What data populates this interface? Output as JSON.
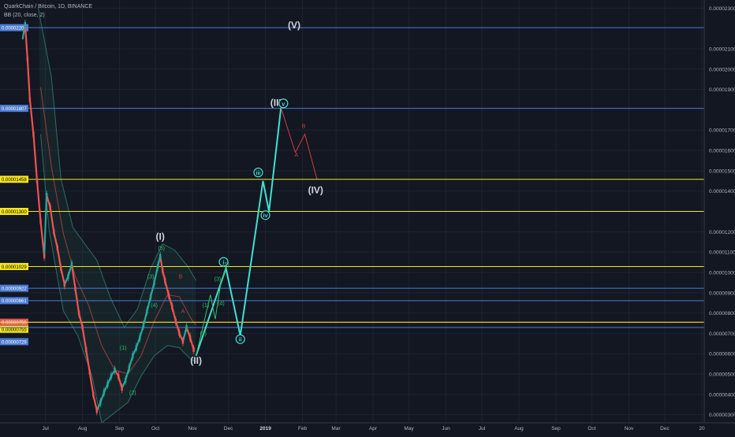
{
  "header": {
    "symbol_line": "QuarkChain / Bitcoin, 1D, BINANCE",
    "indicator_line": "BB (20, close, 2)"
  },
  "colors": {
    "background": "#131722",
    "grid": "#1f2330",
    "candle_up": "#26a69a",
    "candle_down": "#ef5350",
    "bb_band": "#2b6f5f",
    "bb_basis": "#9a3d3d",
    "wave_main": "#40e0d0",
    "wave_sub": "#2fbf6a",
    "wave_corr": "#d13b3b",
    "line_blue": "#4a7bd3",
    "line_yellow": "#f5e51b",
    "line_red": "#e05555"
  },
  "chart_data": {
    "type": "candlestick",
    "title": "QuarkChain / Bitcoin, 1D, BINANCE",
    "indicator": "BB (20, close, 2)",
    "y_ticks": [
      "0.00002300",
      "0.00002100",
      "0.00002000",
      "0.00001900",
      "0.00001700",
      "0.00001600",
      "0.00001500",
      "0.00001400",
      "0.00001200",
      "0.00001100",
      "0.00001000",
      "0.00000900",
      "0.00000800",
      "0.00000700",
      "0.00000600",
      "0.00000500",
      "0.00000400",
      "0.00000300"
    ],
    "y_tick_values": [
      2.3e-05,
      2.1e-05,
      2e-05,
      1.9e-05,
      1.7e-05,
      1.6e-05,
      1.5e-05,
      1.4e-05,
      1.2e-05,
      1.1e-05,
      1e-05,
      9e-06,
      8e-06,
      7e-06,
      6e-06,
      5e-06,
      4e-06,
      3e-06
    ],
    "ylim": [
      2.6e-06,
      2.34e-05
    ],
    "x_ticks": [
      "Jul",
      "Aug",
      "Sep",
      "Oct",
      "Nov",
      "Dec",
      "2019",
      "Feb",
      "Mar",
      "Apr",
      "May",
      "Jun",
      "Jul",
      "Aug",
      "Sep",
      "Oct",
      "Nov",
      "Dec",
      "20"
    ],
    "x_tick_dates": [
      "2018-07-01",
      "2018-08-01",
      "2018-09-01",
      "2018-10-01",
      "2018-11-01",
      "2018-12-01",
      "2019-01-01",
      "2019-02-01",
      "2019-03-01",
      "2019-04-01",
      "2019-05-01",
      "2019-06-01",
      "2019-07-01",
      "2019-08-01",
      "2019-09-01",
      "2019-10-01",
      "2019-11-01",
      "2019-12-01",
      "2020-01-01"
    ],
    "xlim": [
      "2018-05-24",
      "2020-01-03"
    ],
    "price_lines": [
      {
        "label": "0.00002204",
        "value": 2.204e-05,
        "color": "blue"
      },
      {
        "label": "0.00001807",
        "value": 1.807e-05,
        "color": "blue"
      },
      {
        "label": "0.00001458",
        "value": 1.458e-05,
        "color": "yellow"
      },
      {
        "label": "0.00001300",
        "value": 1.3e-05,
        "color": "yellow"
      },
      {
        "label": "0.00001029",
        "value": 1.029e-05,
        "color": "yellow"
      },
      {
        "label": "0.00000922",
        "value": 9.22e-06,
        "color": "blue"
      },
      {
        "label": "0.00000861",
        "value": 8.61e-06,
        "color": "blue"
      },
      {
        "label": "0.00000755",
        "value": 7.55e-06,
        "color": "red"
      },
      {
        "label": "0.00000755",
        "value": 7.55e-06,
        "color": "yellow"
      },
      {
        "label": "0.00000729",
        "value": 7.29e-06,
        "color": "blue"
      }
    ],
    "price_path": [
      [
        "2018-06-12",
        2.15e-05
      ],
      [
        "2018-06-14",
        2.22e-05
      ],
      [
        "2018-06-16",
        2.05e-05
      ],
      [
        "2018-06-18",
        1.85e-05
      ],
      [
        "2018-06-21",
        1.68e-05
      ],
      [
        "2018-06-24",
        1.45e-05
      ],
      [
        "2018-06-27",
        1.25e-05
      ],
      [
        "2018-06-30",
        1.08e-05
      ],
      [
        "2018-07-02",
        1.38e-05
      ],
      [
        "2018-07-05",
        1.32e-05
      ],
      [
        "2018-07-08",
        1.2e-05
      ],
      [
        "2018-07-11",
        1.12e-05
      ],
      [
        "2018-07-14",
        1.02e-05
      ],
      [
        "2018-07-17",
        9.4e-06
      ],
      [
        "2018-07-20",
        9.8e-06
      ],
      [
        "2018-07-23",
        1.04e-05
      ],
      [
        "2018-07-26",
        9.2e-06
      ],
      [
        "2018-07-29",
        8e-06
      ],
      [
        "2018-08-01",
        7.3e-06
      ],
      [
        "2018-08-04",
        6.2e-06
      ],
      [
        "2018-08-07",
        5.1e-06
      ],
      [
        "2018-08-10",
        4e-06
      ],
      [
        "2018-08-13",
        3.2e-06
      ],
      [
        "2018-08-16",
        3.6e-06
      ],
      [
        "2018-08-19",
        4.1e-06
      ],
      [
        "2018-08-22",
        4.5e-06
      ],
      [
        "2018-08-25",
        4.9e-06
      ],
      [
        "2018-08-28",
        5.2e-06
      ],
      [
        "2018-08-31",
        4.9e-06
      ],
      [
        "2018-09-03",
        4.3e-06
      ],
      [
        "2018-09-06",
        4.7e-06
      ],
      [
        "2018-09-09",
        5.3e-06
      ],
      [
        "2018-09-12",
        5.9e-06
      ],
      [
        "2018-09-15",
        6.3e-06
      ],
      [
        "2018-09-18",
        6.8e-06
      ],
      [
        "2018-09-21",
        7.4e-06
      ],
      [
        "2018-09-24",
        8.1e-06
      ],
      [
        "2018-09-27",
        8.8e-06
      ],
      [
        "2018-09-30",
        9.5e-06
      ],
      [
        "2018-10-03",
        1.03e-05
      ],
      [
        "2018-10-05",
        1.08e-05
      ],
      [
        "2018-10-07",
        1.01e-05
      ],
      [
        "2018-10-09",
        9.6e-06
      ],
      [
        "2018-10-12",
        8.9e-06
      ],
      [
        "2018-10-15",
        8.3e-06
      ],
      [
        "2018-10-18",
        7.6e-06
      ],
      [
        "2018-10-21",
        7e-06
      ],
      [
        "2018-10-24",
        6.6e-06
      ],
      [
        "2018-10-27",
        7.3e-06
      ],
      [
        "2018-10-30",
        6.8e-06
      ],
      [
        "2018-11-02",
        6.2e-06
      ]
    ],
    "bb_upper": [
      [
        "2018-06-25",
        2.3e-05
      ],
      [
        "2018-07-06",
        1.96e-05
      ],
      [
        "2018-07-14",
        1.46e-05
      ],
      [
        "2018-07-24",
        1.22e-05
      ],
      [
        "2018-08-03",
        1.14e-05
      ],
      [
        "2018-08-13",
        1.06e-05
      ],
      [
        "2018-08-24",
        8.8e-06
      ],
      [
        "2018-09-05",
        7.3e-06
      ],
      [
        "2018-09-16",
        8.2e-06
      ],
      [
        "2018-09-27",
        1.02e-05
      ],
      [
        "2018-10-07",
        1.14e-05
      ],
      [
        "2018-10-17",
        1.11e-05
      ],
      [
        "2018-10-28",
        1.03e-05
      ],
      [
        "2018-11-04",
        9.6e-06
      ]
    ],
    "bb_lower": [
      [
        "2018-06-27",
        1.68e-05
      ],
      [
        "2018-07-04",
        1.21e-05
      ],
      [
        "2018-07-16",
        8.1e-06
      ],
      [
        "2018-07-28",
        6.9e-06
      ],
      [
        "2018-08-09",
        4.9e-06
      ],
      [
        "2018-08-17",
        2.6e-06
      ],
      [
        "2018-08-28",
        3.1e-06
      ],
      [
        "2018-09-08",
        3.6e-06
      ],
      [
        "2018-09-19",
        4.9e-06
      ],
      [
        "2018-09-30",
        5.9e-06
      ],
      [
        "2018-10-11",
        6.4e-06
      ],
      [
        "2018-10-21",
        6.3e-06
      ],
      [
        "2018-10-31",
        5.7e-06
      ],
      [
        "2018-11-04",
        5.6e-06
      ]
    ],
    "bb_basis": [
      [
        "2018-06-27",
        1.91e-05
      ],
      [
        "2018-07-06",
        1.52e-05
      ],
      [
        "2018-07-16",
        1.19e-05
      ],
      [
        "2018-07-26",
        9.8e-06
      ],
      [
        "2018-08-06",
        8.4e-06
      ],
      [
        "2018-08-17",
        6.4e-06
      ],
      [
        "2018-08-28",
        5.2e-06
      ],
      [
        "2018-09-08",
        5e-06
      ],
      [
        "2018-09-19",
        5.9e-06
      ],
      [
        "2018-09-30",
        7.6e-06
      ],
      [
        "2018-10-11",
        8.9e-06
      ],
      [
        "2018-10-21",
        8.8e-06
      ],
      [
        "2018-10-31",
        7.7e-06
      ],
      [
        "2018-11-04",
        7.4e-06
      ]
    ],
    "wave_projection": [
      [
        "2018-11-04",
        5.9e-06
      ],
      [
        "2018-11-29",
        1.02e-05
      ],
      [
        "2018-12-11",
        6.9e-06
      ],
      [
        "2018-12-30",
        1.45e-05
      ],
      [
        "2019-01-04",
        1.3e-05
      ],
      [
        "2019-01-14",
        1.81e-05
      ]
    ],
    "wave_sub": [
      [
        "2018-11-04",
        5.9e-06
      ],
      [
        "2018-11-16",
        8.9e-06
      ],
      [
        "2018-11-20",
        7.7e-06
      ],
      [
        "2018-11-25",
        9.6e-06
      ],
      [
        "2018-11-29",
        1.02e-05
      ]
    ],
    "wave_correction": [
      [
        "2019-01-14",
        1.81e-05
      ],
      [
        "2019-01-26",
        1.59e-05
      ],
      [
        "2019-02-03",
        1.68e-05
      ],
      [
        "2019-02-13",
        1.46e-05
      ]
    ],
    "wave_labels": [
      {
        "text": "(V)",
        "date": "2019-01-25",
        "value": 2.2e-05,
        "style": "major"
      },
      {
        "text": "(III)",
        "date": "2019-01-11",
        "value": 1.82e-05,
        "style": "major"
      },
      {
        "text": "(IV)",
        "date": "2019-02-12",
        "value": 1.39e-05,
        "style": "major"
      },
      {
        "text": "(I)",
        "date": "2018-10-05",
        "value": 1.16e-05,
        "style": "major"
      },
      {
        "text": "(II)",
        "date": "2018-11-04",
        "value": 5.5e-06,
        "style": "major"
      },
      {
        "text": "i",
        "date": "2018-11-27",
        "value": 1.04e-05,
        "style": "circle"
      },
      {
        "text": "ii",
        "date": "2018-12-11",
        "value": 6.6e-06,
        "style": "circle"
      },
      {
        "text": "iii",
        "date": "2018-12-26",
        "value": 1.48e-05,
        "style": "circle"
      },
      {
        "text": "iv",
        "date": "2019-01-01",
        "value": 1.27e-05,
        "style": "circle"
      },
      {
        "text": "v",
        "date": "2019-01-16",
        "value": 1.82e-05,
        "style": "circle"
      },
      {
        "text": "(5)",
        "date": "2018-10-06",
        "value": 1.11e-05,
        "style": "sub"
      },
      {
        "text": "(3)",
        "date": "2018-09-27",
        "value": 9.7e-06,
        "style": "sub"
      },
      {
        "text": "(4)",
        "date": "2018-09-30",
        "value": 8.3e-06,
        "style": "sub"
      },
      {
        "text": "(1)",
        "date": "2018-09-04",
        "value": 6.2e-06,
        "style": "sub"
      },
      {
        "text": "(2)",
        "date": "2018-09-12",
        "value": 4e-06,
        "style": "sub"
      },
      {
        "text": "(1)",
        "date": "2018-11-12",
        "value": 8.3e-06,
        "style": "sub"
      },
      {
        "text": "(2)",
        "date": "2018-11-10",
        "value": 6.9e-06,
        "style": "sub"
      },
      {
        "text": "(3)",
        "date": "2018-11-22",
        "value": 9.6e-06,
        "style": "sub"
      },
      {
        "text": "(4)",
        "date": "2018-11-25",
        "value": 8.4e-06,
        "style": "sub"
      },
      {
        "text": "(5)",
        "date": "2018-11-29",
        "value": 1.03e-05,
        "style": "sub"
      },
      {
        "text": "B",
        "date": "2018-10-22",
        "value": 9.7e-06,
        "style": "corr"
      },
      {
        "text": "A",
        "date": "2018-10-24",
        "value": 8e-06,
        "style": "corr"
      },
      {
        "text": "B",
        "date": "2019-02-02",
        "value": 1.71e-05,
        "style": "corr"
      },
      {
        "text": "A",
        "date": "2019-01-27",
        "value": 1.57e-05,
        "style": "corr"
      }
    ]
  }
}
